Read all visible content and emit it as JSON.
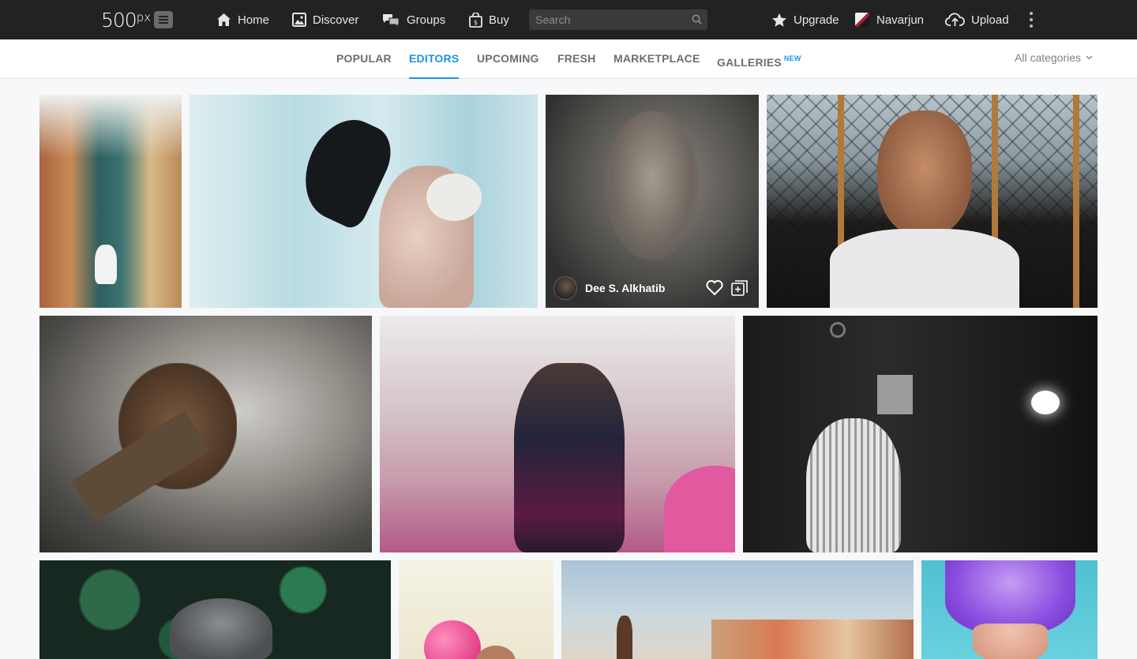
{
  "header": {
    "logo_text": "500",
    "logo_sup": "px",
    "nav": {
      "home": "Home",
      "discover": "Discover",
      "groups": "Groups",
      "buy": "Buy"
    },
    "search_placeholder": "Search",
    "upgrade": "Upgrade",
    "user_name": "Navarjun",
    "upload": "Upload"
  },
  "subnav": {
    "tabs": [
      "POPULAR",
      "EDITORS",
      "UPCOMING",
      "FRESH",
      "MARKETPLACE",
      "GALLERIES"
    ],
    "active_tab": "EDITORS",
    "galleries_badge": "NEW",
    "categories_label": "All categories"
  },
  "hovered_photo": {
    "author": "Dee S. Alkhatib"
  },
  "colors": {
    "topbar_bg": "#222222",
    "accent": "#1b94e0",
    "page_bg": "#f7f8fa"
  }
}
